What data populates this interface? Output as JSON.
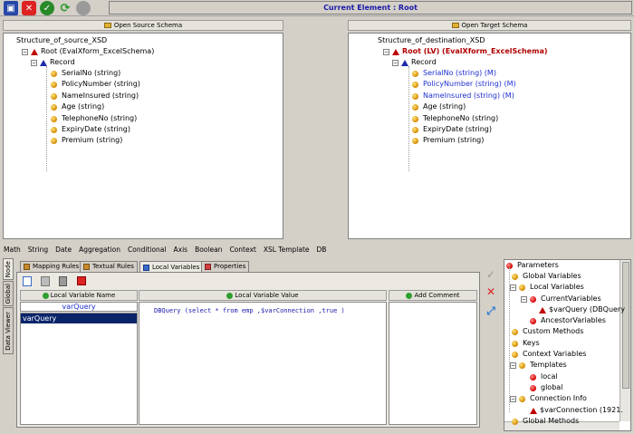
{
  "toolbar": {
    "current_element": "Current Element : Root",
    "icons": [
      "save-icon",
      "cancel-icon",
      "ok-icon",
      "refresh-icon",
      "stop-icon"
    ]
  },
  "source": {
    "open_label": "Open Source Schema",
    "root_label": "Structure_of_source_XSD",
    "root_node": "Root  (EvalXform_ExcelSchema)",
    "record": "Record",
    "fields": [
      "SerialNo  (string)",
      "PolicyNumber  (string)",
      "NameInsured  (string)",
      "Age  (string)",
      "TelephoneNo  (string)",
      "ExpiryDate  (string)",
      "Premium  (string)"
    ]
  },
  "target": {
    "open_label": "Open Target Schema",
    "root_label": "Structure_of_destination_XSD",
    "root_node": "Root  (LV)  (EvalXform_ExcelSchema)",
    "record": "Record",
    "mapped_fields": [
      "SerialNo  (string)  (M)",
      "PolicyNumber  (string)  (M)",
      "NameInsured  (string)  (M)"
    ],
    "fields": [
      "Age  (string)",
      "TelephoneNo  (string)",
      "ExpiryDate  (string)",
      "Premium  (string)"
    ]
  },
  "menu": [
    "Math",
    "String",
    "Date",
    "Aggregation",
    "Conditional",
    "Axis",
    "Boolean",
    "Context",
    "XSL Template",
    "DB"
  ],
  "side_tabs": [
    "Node",
    "Global",
    "Data Viewer"
  ],
  "tabs": [
    "Mapping Rules",
    "Textual Rules",
    "Local Variables",
    "Properties"
  ],
  "columns": {
    "name": "Local Variable Name",
    "value": "Local Variable Value",
    "comment": "Add Comment"
  },
  "variable": {
    "name_input": "varQuery",
    "list_item": "varQuery",
    "value": "DBQuery (select * from emp ,$varConnection ,true )"
  },
  "params": {
    "root": "Parameters",
    "global": "Global Variables",
    "local": "Local Variables",
    "current": "CurrentVariables",
    "varquery": "$varQuery  (DBQuery",
    "ancestor": "AncestorVariables",
    "custom": "Custom Methods",
    "keys": "Keys",
    "context": "Context Variables",
    "templates": "Templates",
    "t_local": "local",
    "t_global": "global",
    "conn": "Connection Info",
    "varconn": "$varConnection  (1921.",
    "more": "Global Methods"
  }
}
